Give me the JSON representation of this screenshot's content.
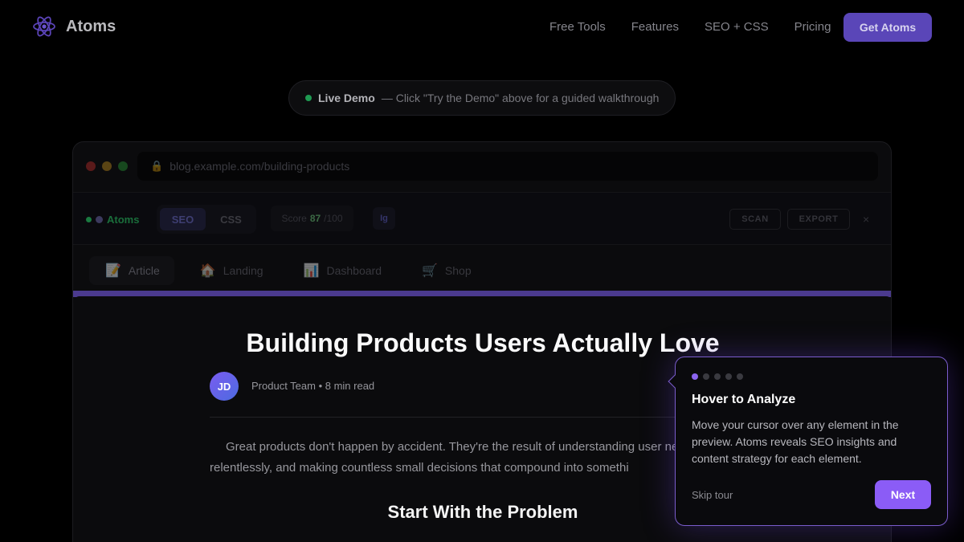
{
  "brand": {
    "name": "Atoms"
  },
  "nav": {
    "links": [
      "Free Tools",
      "Features",
      "SEO + CSS",
      "Pricing"
    ],
    "cta": "Get Atoms"
  },
  "banner": {
    "label": "Live Demo",
    "text": "— Click \"Try the Demo\" above for a guided walkthrough"
  },
  "browser": {
    "url": "blog.example.com/building-products",
    "toolbar": {
      "brand": "Atoms",
      "modes": [
        "SEO",
        "CSS"
      ],
      "score_label": "Score",
      "score_value": "87",
      "score_max": "/100",
      "ig_label": "Ig",
      "scan": "SCAN",
      "export": "EXPORT",
      "close": "×"
    },
    "tabs": [
      {
        "label": "Article",
        "icon": "📝"
      },
      {
        "label": "Landing",
        "icon": "🏠"
      },
      {
        "label": "Dashboard",
        "icon": "📊"
      },
      {
        "label": "Shop",
        "icon": "🛒"
      }
    ]
  },
  "article": {
    "title": "Building Products Users Actually Love",
    "author_initials": "JD",
    "byline": "Product Team • 8 min read",
    "paragraph": "Great products don't happen by accident. They're the result of understanding user ne iterating relentlessly, and making countless small decisions that compound into somethi",
    "heading": "Start With the Problem"
  },
  "tour": {
    "step": 1,
    "total_steps": 5,
    "title": "Hover to Analyze",
    "body": "Move your cursor over any element in the preview. Atoms reveals SEO insights and content strategy for each element.",
    "skip": "Skip tour",
    "next": "Next"
  }
}
